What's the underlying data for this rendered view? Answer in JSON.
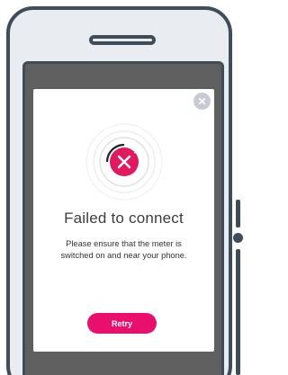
{
  "colors": {
    "frame": "#3f4c5a",
    "phone_body": "#e9edf2",
    "overlay": "#5f5f5f",
    "accent": "#e9106d",
    "close_button": "#c6cbd1"
  },
  "dialog": {
    "close_icon": "close-icon",
    "status_icon": "error-x-icon",
    "title": "Failed to connect",
    "message": "Please ensure that the meter is switched on and near your phone.",
    "retry_label": "Retry"
  }
}
